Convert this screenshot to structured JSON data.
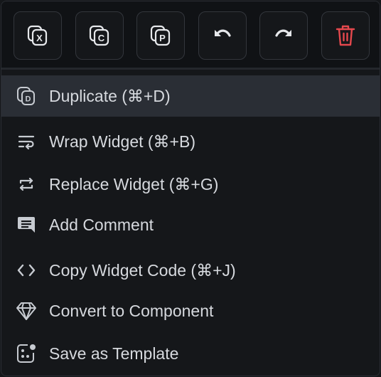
{
  "toolbar": {
    "buttons": [
      {
        "icon": "cut-icon",
        "letter": "X"
      },
      {
        "icon": "copy-icon",
        "letter": "C"
      },
      {
        "icon": "paste-icon",
        "letter": "P"
      },
      {
        "icon": "undo-icon"
      },
      {
        "icon": "redo-icon"
      },
      {
        "icon": "trash-icon",
        "color": "#e5484d"
      }
    ]
  },
  "menu": {
    "items": [
      {
        "icon": "duplicate-icon",
        "label": "Duplicate (⌘+D)",
        "active": true
      },
      {
        "icon": "wrap-icon",
        "label": "Wrap Widget (⌘+B)"
      },
      {
        "icon": "replace-icon",
        "label": "Replace Widget (⌘+G)"
      },
      {
        "icon": "comment-icon",
        "label": "Add Comment"
      },
      {
        "icon": "code-icon",
        "label": "Copy Widget Code (⌘+J)"
      },
      {
        "icon": "diamond-icon",
        "label": "Convert to Component"
      },
      {
        "icon": "template-icon",
        "label": "Save as Template"
      }
    ]
  },
  "colors": {
    "background": "#15171a",
    "toolbar_bg": "#101215",
    "active_row": "#2a2e35",
    "text": "#d6d9de",
    "danger": "#e5484d"
  }
}
